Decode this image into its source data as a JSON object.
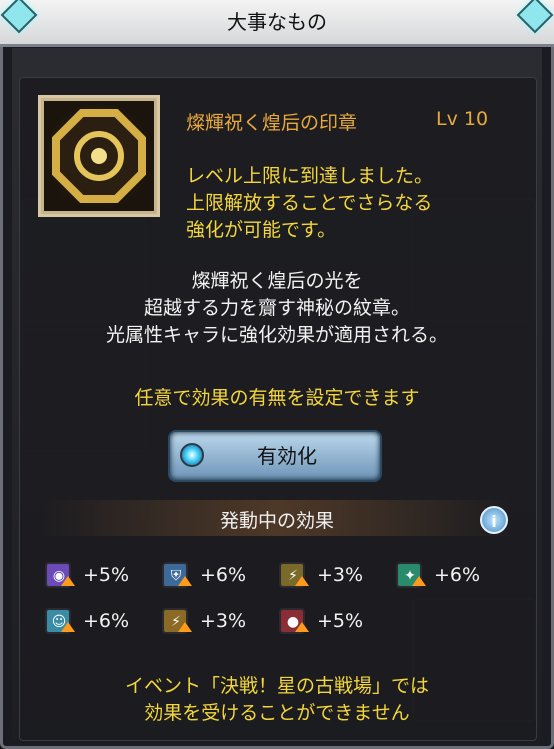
{
  "window": {
    "title": "大事なもの"
  },
  "item": {
    "name": "燦輝祝く煌后の印章",
    "level": "Lv 10",
    "max_level_message": [
      "レベル上限に到達しました。",
      "上限解放することでさらなる",
      "強化が可能です。"
    ],
    "description": [
      "燦輝祝く煌后の光を",
      "超越する力を齎す神秘の紋章。",
      "光属性キャラに強化効果が適用される。"
    ],
    "icon": "octagonal-sun-seal"
  },
  "setting": {
    "prompt": "任意で効果の有無を設定できます",
    "toggle_label": "有効化"
  },
  "effects": {
    "title": "発動中の効果",
    "info_icon": "info-icon",
    "items": [
      {
        "icon": "purple-swirl-buff",
        "value": "+5%",
        "color": "#6b4bb8"
      },
      {
        "icon": "blue-shield-buff",
        "value": "+6%",
        "color": "#3e6a9a"
      },
      {
        "icon": "yellow-bolt-buff",
        "value": "+3%",
        "color": "#7a6a2a"
      },
      {
        "icon": "green-sparkle-buff",
        "value": "+6%",
        "color": "#2a8b6c"
      },
      {
        "icon": "cyan-person-buff",
        "value": "+6%",
        "color": "#3a8ca6"
      },
      {
        "icon": "gold-triple-buff",
        "value": "+3%",
        "color": "#8a6a24"
      },
      {
        "icon": "red-orb-buff",
        "value": "+5%",
        "color": "#8a2d35"
      }
    ]
  },
  "notice": [
    "イベント「決戦！星の古戦場」では",
    "効果を受けることができません"
  ]
}
